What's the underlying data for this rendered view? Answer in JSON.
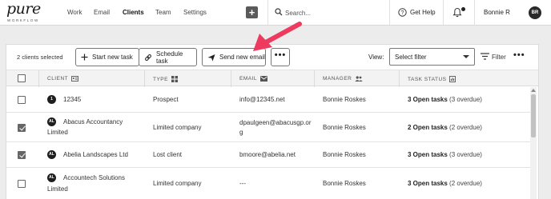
{
  "app": {
    "logo_text": "pure",
    "logo_subtext": "WORKFLOW"
  },
  "nav": {
    "items": [
      {
        "label": "Work"
      },
      {
        "label": "Email"
      },
      {
        "label": "Clients",
        "active": true
      },
      {
        "label": "Team"
      },
      {
        "label": "Settings"
      }
    ],
    "add_label": "+"
  },
  "search": {
    "placeholder": "Search..."
  },
  "help": {
    "label": "Get Help"
  },
  "user": {
    "name": "Bonnie R",
    "initials": "BR"
  },
  "toolbar": {
    "selected_count": "2 clients selected",
    "start_task": "Start new task",
    "schedule_task": "Schedule task",
    "send_email": "Send new email",
    "more": "•••",
    "view_label": "View:",
    "view_select": "Select filter",
    "filter_label": "Filter",
    "kebab": "•••"
  },
  "table": {
    "columns": [
      "CLIENT",
      "TYPE",
      "EMAIL",
      "MANAGER",
      "TASK STATUS"
    ],
    "rows": [
      {
        "initials": "1",
        "client_line1": "12345",
        "client_line2": "",
        "type": "Prospect",
        "email_line1": "info@12345.net",
        "email_line2": "",
        "manager": "Bonnie Roskes",
        "task_bold": "3 Open tasks",
        "task_rest": " (3 overdue)",
        "checked": false
      },
      {
        "initials": "AL",
        "client_line1": "Abacus Accountancy",
        "client_line2": "Limited",
        "type": "Limited company",
        "email_line1": "dpaulgeen@abacusgp.or",
        "email_line2": "g",
        "manager": "Bonnie Roskes",
        "task_bold": "2 Open tasks",
        "task_rest": " (2 overdue)",
        "checked": true
      },
      {
        "initials": "AL",
        "client_line1": "Abelia Landscapes Ltd",
        "client_line2": "",
        "type": "Lost client",
        "email_line1": "bmoore@abelia.net",
        "email_line2": "",
        "manager": "Bonnie Roskes",
        "task_bold": "3 Open tasks",
        "task_rest": " (3 overdue)",
        "checked": true
      },
      {
        "initials": "AL",
        "client_line1": "Accountech Solutions",
        "client_line2": "Limited",
        "type": "Limited company",
        "email_line1": "---",
        "email_line2": "",
        "manager": "Bonnie Roskes",
        "task_bold": "3 Open tasks",
        "task_rest": " (2 overdue)",
        "checked": false
      }
    ]
  },
  "colors": {
    "annotation_arrow": "#ee3a5e",
    "avatar_bg": "#2a2a2a"
  }
}
